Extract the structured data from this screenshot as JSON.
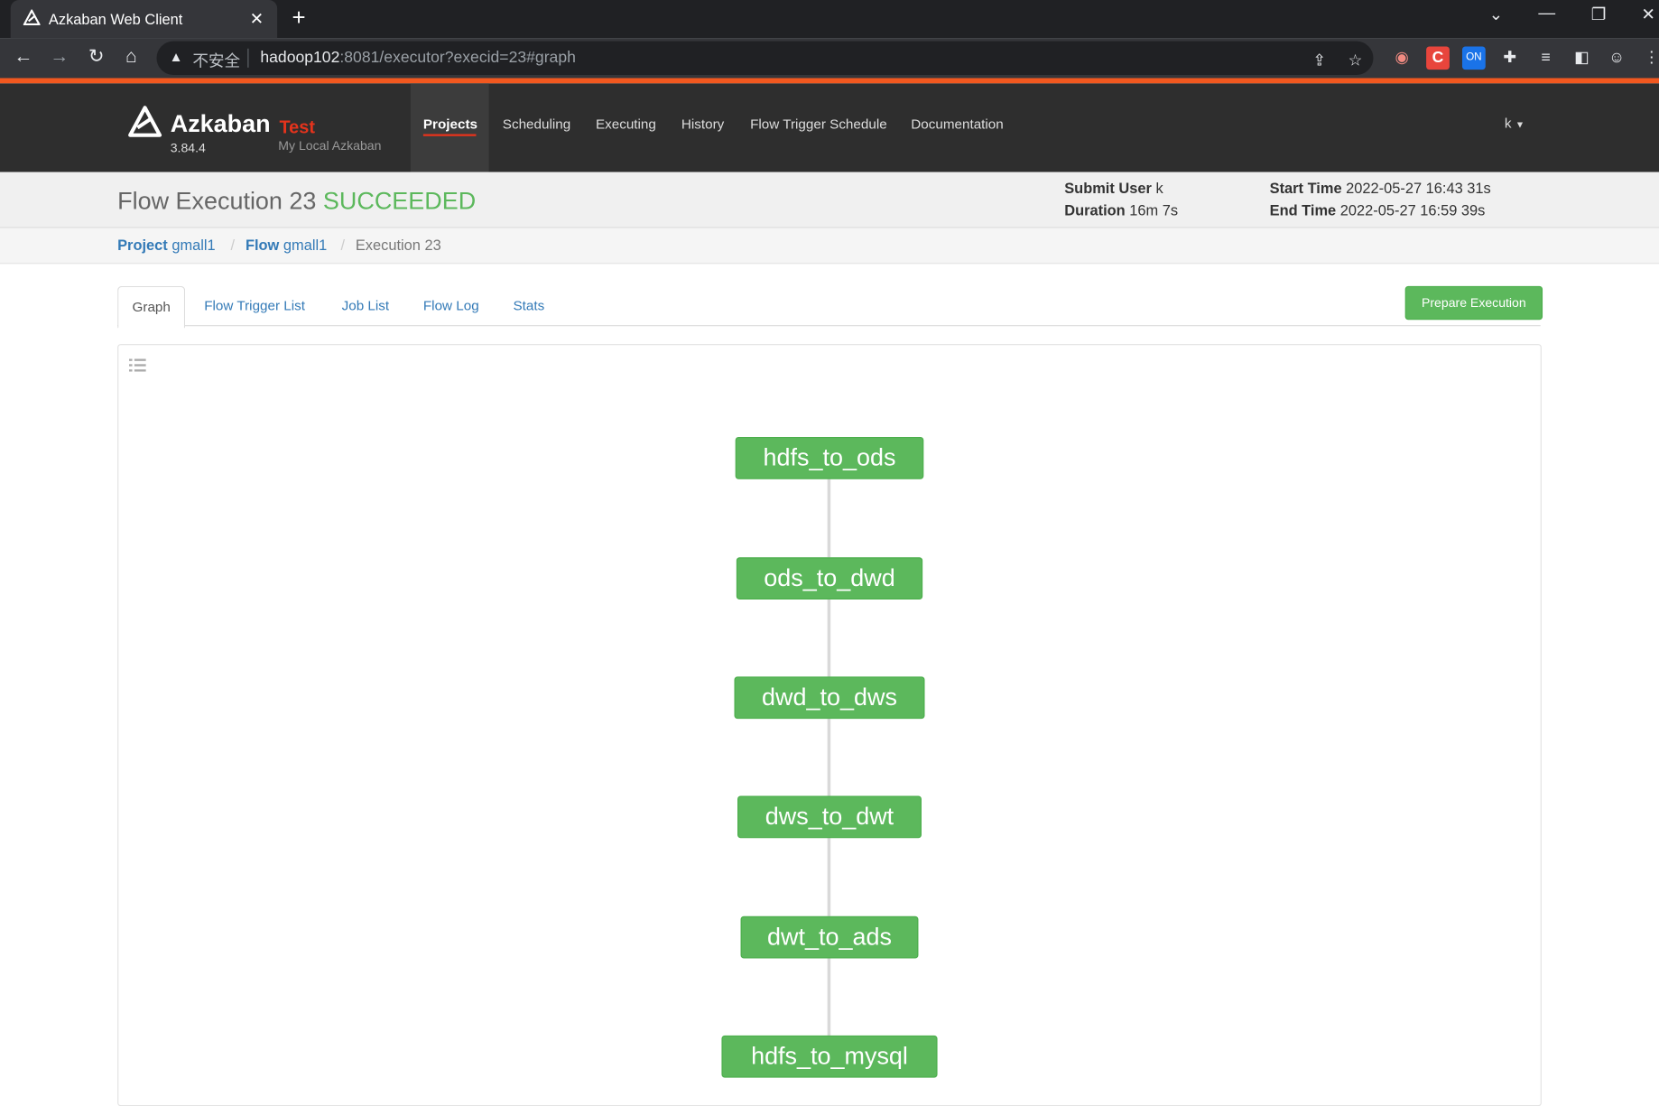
{
  "browser": {
    "tab_title": "Azkaban Web Client",
    "insecure_label": "不安全",
    "url_host": "hadoop102",
    "url_rest": ":8081/executor?execid=23#graph"
  },
  "header": {
    "brand": "Azkaban",
    "env": "Test",
    "version": "3.84.4",
    "subtitle": "My Local Azkaban",
    "nav": [
      "Projects",
      "Scheduling",
      "Executing",
      "History",
      "Flow Trigger Schedule",
      "Documentation"
    ],
    "user": "k"
  },
  "execution": {
    "title_prefix": "Flow Execution 23",
    "status": "SUCCEEDED",
    "submit_user_label": "Submit User",
    "submit_user": "k",
    "duration_label": "Duration",
    "duration": "16m 7s",
    "start_time_label": "Start Time",
    "start_time": "2022-05-27 16:43 31s",
    "end_time_label": "End Time",
    "end_time": "2022-05-27 16:59 39s"
  },
  "breadcrumb": {
    "project_label": "Project",
    "project": "gmall1",
    "flow_label": "Flow",
    "flow": "gmall1",
    "current": "Execution 23"
  },
  "tabs": [
    "Graph",
    "Flow Trigger List",
    "Job List",
    "Flow Log",
    "Stats"
  ],
  "prepare_button": "Prepare Execution",
  "graph": {
    "nodes": [
      "hdfs_to_ods",
      "ods_to_dwd",
      "dwd_to_dws",
      "dws_to_dwt",
      "dwt_to_ads",
      "hdfs_to_mysql"
    ],
    "node_color": "#5cb85c"
  }
}
